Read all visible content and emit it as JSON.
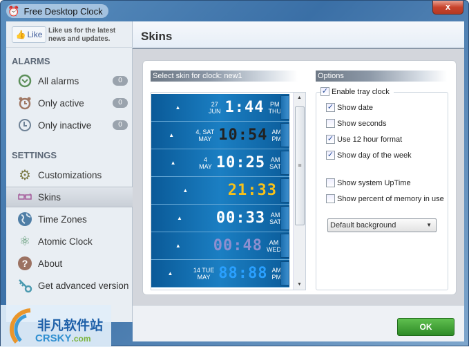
{
  "window": {
    "title": "Free Desktop Clock",
    "close_label": "x"
  },
  "sidebar": {
    "like_label": "Like",
    "like_text_1": "Like us for the latest",
    "like_text_2": "news and updates.",
    "alarms_heading": "ALARMS",
    "alarms": [
      {
        "label": "All alarms",
        "count": "0",
        "icon": "clock-icon"
      },
      {
        "label": "Only active",
        "count": "0",
        "icon": "alarm-clock-icon"
      },
      {
        "label": "Only inactive",
        "count": "0",
        "icon": "clock-outline-icon"
      }
    ],
    "settings_heading": "SETTINGS",
    "settings": [
      {
        "label": "Customizations",
        "icon": "gear-icon"
      },
      {
        "label": "Skins",
        "icon": "glasses-icon",
        "selected": true
      },
      {
        "label": "Time Zones",
        "icon": "globe-icon"
      },
      {
        "label": "Atomic Clock",
        "icon": "atom-icon"
      },
      {
        "label": "About",
        "icon": "question-icon"
      },
      {
        "label": "Get advanced version",
        "icon": "key-icon"
      }
    ]
  },
  "main": {
    "title": "Skins",
    "skin_header": "Select skin for clock: new1",
    "skins": [
      {
        "date_top": "27",
        "date_bottom": "JUN",
        "time": "1:44",
        "ampm": "PM",
        "day": "THU"
      },
      {
        "date_top": "4, SAT",
        "date_bottom": "MAY",
        "time": "10:54",
        "ampm": "AM",
        "day": "PM"
      },
      {
        "date_top": "4",
        "date_bottom": "MAY",
        "time": "10:25",
        "ampm": "AM",
        "day": "SAT"
      },
      {
        "date_top": "",
        "date_bottom": "",
        "time": "21:33",
        "ampm": "",
        "day": ""
      },
      {
        "date_top": "",
        "date_bottom": "",
        "time": "00:33",
        "ampm": "AM",
        "day": "SAT"
      },
      {
        "date_top": "",
        "date_bottom": "",
        "time": "00:48",
        "ampm": "AM",
        "day": "WED"
      },
      {
        "date_top": "14 TUE",
        "date_bottom": "MAY",
        "time": "88:88",
        "ampm": "AM",
        "day": "PM"
      }
    ],
    "options_header": "Options",
    "options": {
      "enable_tray": {
        "label": "Enable tray clock",
        "checked": true
      },
      "show_date": {
        "label": "Show date",
        "checked": true
      },
      "show_seconds": {
        "label": "Show seconds",
        "checked": false
      },
      "use_12h": {
        "label": "Use 12 hour format",
        "checked": true
      },
      "show_day": {
        "label": "Show day of the week",
        "checked": true
      },
      "show_uptime": {
        "label": "Show system UpTime",
        "checked": false
      },
      "show_memory": {
        "label": "Show percent of memory in use",
        "checked": false
      }
    },
    "background_select": "Default background",
    "ok_label": "OK"
  },
  "watermark": {
    "cn": "非凡软件站",
    "en": "CRSKY",
    "dom": ".com"
  }
}
